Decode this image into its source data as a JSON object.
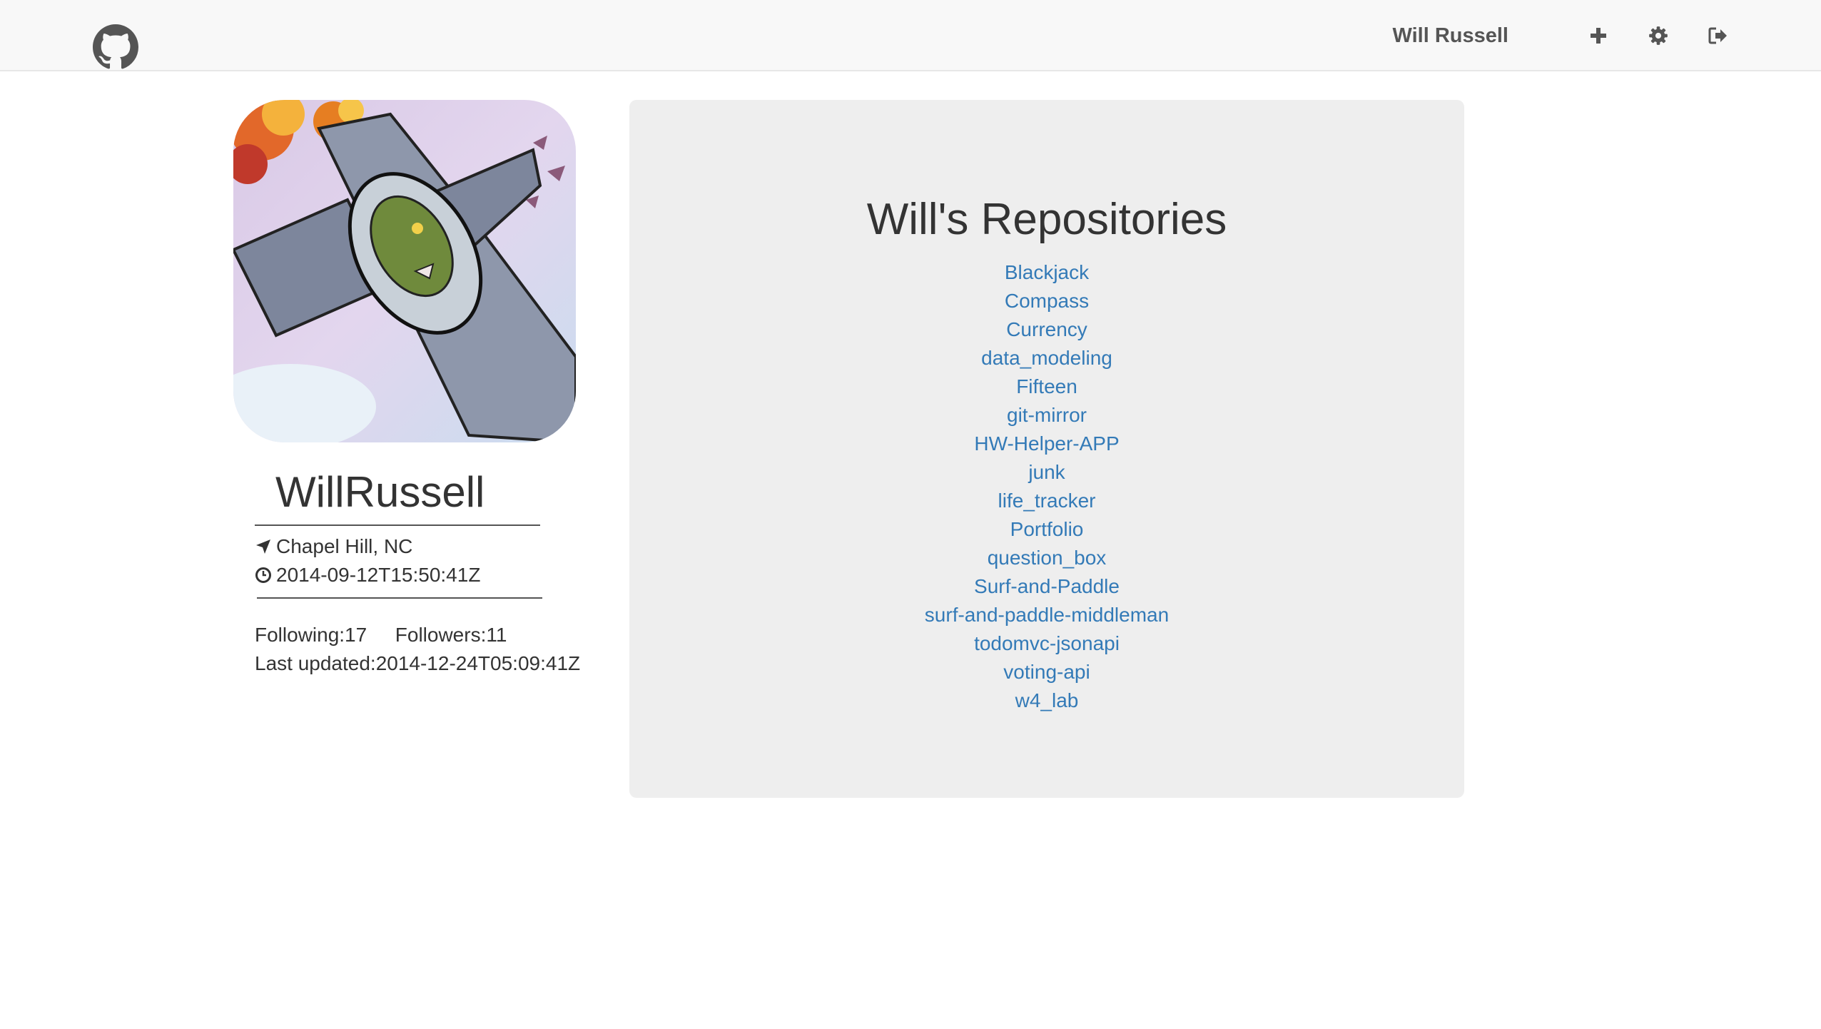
{
  "navbar": {
    "user_name": "Will Russell",
    "icons": [
      "github-logo-icon",
      "plus-icon",
      "gear-icon",
      "log-out-icon"
    ]
  },
  "profile": {
    "username": "WillRussell",
    "location": "Chapel Hill, NC",
    "created_at": "2014-09-12T15:50:41Z",
    "following": "Following:17",
    "followers": "Followers:11",
    "last_updated": "Last updated:2014-12-24T05:09:41Z"
  },
  "repos": {
    "title": "Will's Repositories",
    "items": [
      "Blackjack",
      "Compass",
      "Currency",
      "data_modeling",
      "Fifteen",
      "git-mirror",
      "HW-Helper-APP",
      "junk",
      "life_tracker",
      "Portfolio",
      "question_box",
      "Surf-and-Paddle",
      "surf-and-paddle-middleman",
      "todomvc-jsonapi",
      "voting-api",
      "w4_lab"
    ]
  },
  "colors": {
    "link": "#337ab7",
    "navbar_bg": "#f8f8f8",
    "panel_bg": "#eeeeee"
  }
}
